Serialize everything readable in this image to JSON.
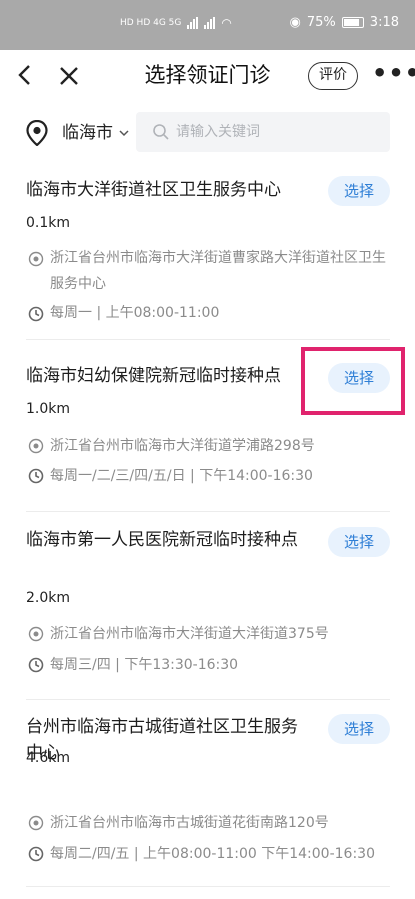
{
  "status_bar": {
    "left_text": "HD HD 4G 5G",
    "battery": "75%",
    "time": "3:18"
  },
  "nav": {
    "title": "选择领证门诊",
    "rate_label": "评价",
    "more_label": "•••"
  },
  "search": {
    "city": "临海市",
    "placeholder": "请输入关键词"
  },
  "select_label": "选择",
  "items": [
    {
      "name": "临海市大洋街道社区卫生服务中心",
      "distance": "0.1km",
      "address": "浙江省台州市临海市大洋街道曹家路大洋街道社区卫生服务中心",
      "hours": "每周一 | 上午08:00-11:00"
    },
    {
      "name": "临海市妇幼保健院新冠临时接种点",
      "distance": "1.0km",
      "address": "浙江省台州市临海市大洋街道学浦路298号",
      "hours": "每周一/二/三/四/五/日 | 下午14:00-16:30"
    },
    {
      "name": "临海市第一人民医院新冠临时接种点",
      "distance": "2.0km",
      "address": "浙江省台州市临海市大洋街道大洋街道375号",
      "hours": "每周三/四 | 下午13:30-16:30"
    },
    {
      "name": "台州市临海市古城街道社区卫生服务中心",
      "distance": "4.6km",
      "address": "浙江省台州市临海市古城街道花街南路120号",
      "hours": "每周二/四/五 | 上午08:00-11:00 下午14:00-16:30"
    }
  ],
  "colors": {
    "accent": "#2f7fd6",
    "button_bg": "#e8f2fd",
    "highlight": "#e0236d",
    "status_bar": "#a9a9a9"
  }
}
